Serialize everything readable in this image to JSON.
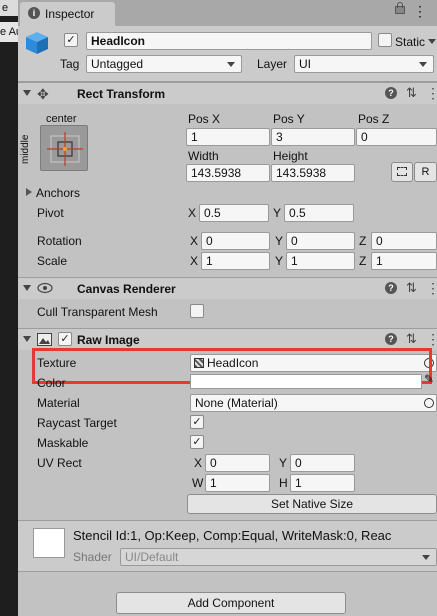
{
  "tab": {
    "title": "Inspector"
  },
  "left_strip": {
    "text1": "e",
    "text2": "e Au"
  },
  "gameobject": {
    "name": "HeadIcon",
    "static_label": "Static",
    "tag_label": "Tag",
    "tag_value": "Untagged",
    "layer_label": "Layer",
    "layer_value": "UI"
  },
  "rect_transform": {
    "title": "Rect Transform",
    "anchor_h": "center",
    "anchor_v": "middle",
    "posx_label": "Pos X",
    "posx": "1",
    "posy_label": "Pos Y",
    "posy": "3",
    "posz_label": "Pos Z",
    "posz": "0",
    "width_label": "Width",
    "width": "143.5938",
    "height_label": "Height",
    "height": "143.5938",
    "r_button": "R",
    "anchors_label": "Anchors",
    "pivot_label": "Pivot",
    "pivot_x": "0.5",
    "pivot_y": "0.5",
    "rotation_label": "Rotation",
    "rot_x": "0",
    "rot_y": "0",
    "rot_z": "0",
    "scale_label": "Scale",
    "scale_x": "1",
    "scale_y": "1",
    "scale_z": "1",
    "x": "X",
    "y": "Y",
    "z": "Z"
  },
  "canvas_renderer": {
    "title": "Canvas Renderer",
    "cull_label": "Cull Transparent Mesh"
  },
  "raw_image": {
    "title": "Raw Image",
    "texture_label": "Texture",
    "texture_value": "HeadIcon",
    "color_label": "Color",
    "material_label": "Material",
    "material_value": "None (Material)",
    "raycast_label": "Raycast Target",
    "maskable_label": "Maskable",
    "uvrect_label": "UV Rect",
    "uv_x": "0",
    "uv_y": "0",
    "uv_w": "1",
    "uv_h": "1",
    "x": "X",
    "y": "Y",
    "w": "W",
    "h": "H",
    "native_size_button": "Set Native Size"
  },
  "material_preview": {
    "stencil_text": "Stencil Id:1, Op:Keep, Comp:Equal, WriteMask:0, Reac",
    "shader_label": "Shader",
    "shader_value": "UI/Default"
  },
  "add_component": "Add Component",
  "icons": {
    "lock": "lock-icon",
    "menu": "kebab-menu-icon",
    "help": "help-icon",
    "preset": "preset-icon",
    "cube": "cube-icon",
    "rect": "rect-transform-icon",
    "eye": "eye-icon",
    "image": "image-icon",
    "texture": "texture-icon",
    "target": "object-picker-icon",
    "eyedropper": "eyedropper-icon"
  },
  "colors": {
    "highlight_border": "#e53935",
    "panel_bg": "#c2c2c2",
    "cube_blue": "#2f8ad7"
  }
}
